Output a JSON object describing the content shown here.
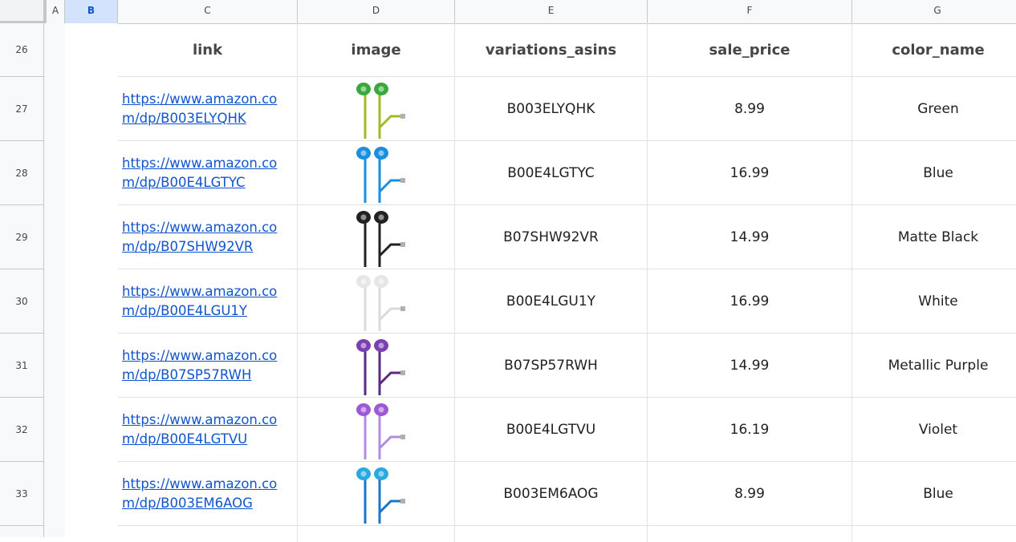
{
  "columns": [
    "A",
    "B",
    "C",
    "D",
    "E",
    "F",
    "G"
  ],
  "rows": [
    "26",
    "27",
    "28",
    "29",
    "30",
    "31",
    "32",
    "33"
  ],
  "headers": {
    "link": "link",
    "image": "image",
    "asin": "variations_asins",
    "price": "sale_price",
    "color": "color_name"
  },
  "records": [
    {
      "link": "https://www.amazon.com/dp/B003ELYQHK",
      "asin": "B003ELYQHK",
      "price": "8.99",
      "color": "Green",
      "hex": "#3aa83a",
      "cord": "#a6b82a"
    },
    {
      "link": "https://www.amazon.com/dp/B00E4LGTYC",
      "asin": "B00E4LGTYC",
      "price": "16.99",
      "color": "Blue",
      "hex": "#1a8fe0",
      "cord": "#1a8fe0"
    },
    {
      "link": "https://www.amazon.com/dp/B07SHW92VR",
      "asin": "B07SHW92VR",
      "price": "14.99",
      "color": "Matte Black",
      "hex": "#222222",
      "cord": "#222222"
    },
    {
      "link": "https://www.amazon.com/dp/B00E4LGU1Y",
      "asin": "B00E4LGU1Y",
      "price": "16.99",
      "color": "White",
      "hex": "#e6e6e6",
      "cord": "#dadada"
    },
    {
      "link": "https://www.amazon.com/dp/B07SP57RWH",
      "asin": "B07SP57RWH",
      "price": "14.99",
      "color": "Metallic Purple",
      "hex": "#7a3fb0",
      "cord": "#5a2a84"
    },
    {
      "link": "https://www.amazon.com/dp/B00E4LGTVU",
      "asin": "B00E4LGTVU",
      "price": "16.19",
      "color": "Violet",
      "hex": "#9b59d6",
      "cord": "#b58be0"
    },
    {
      "link": "https://www.amazon.com/dp/B003EM6AOG",
      "asin": "B003EM6AOG",
      "price": "8.99",
      "color": "Blue",
      "hex": "#28a9e0",
      "cord": "#1976c8"
    }
  ]
}
